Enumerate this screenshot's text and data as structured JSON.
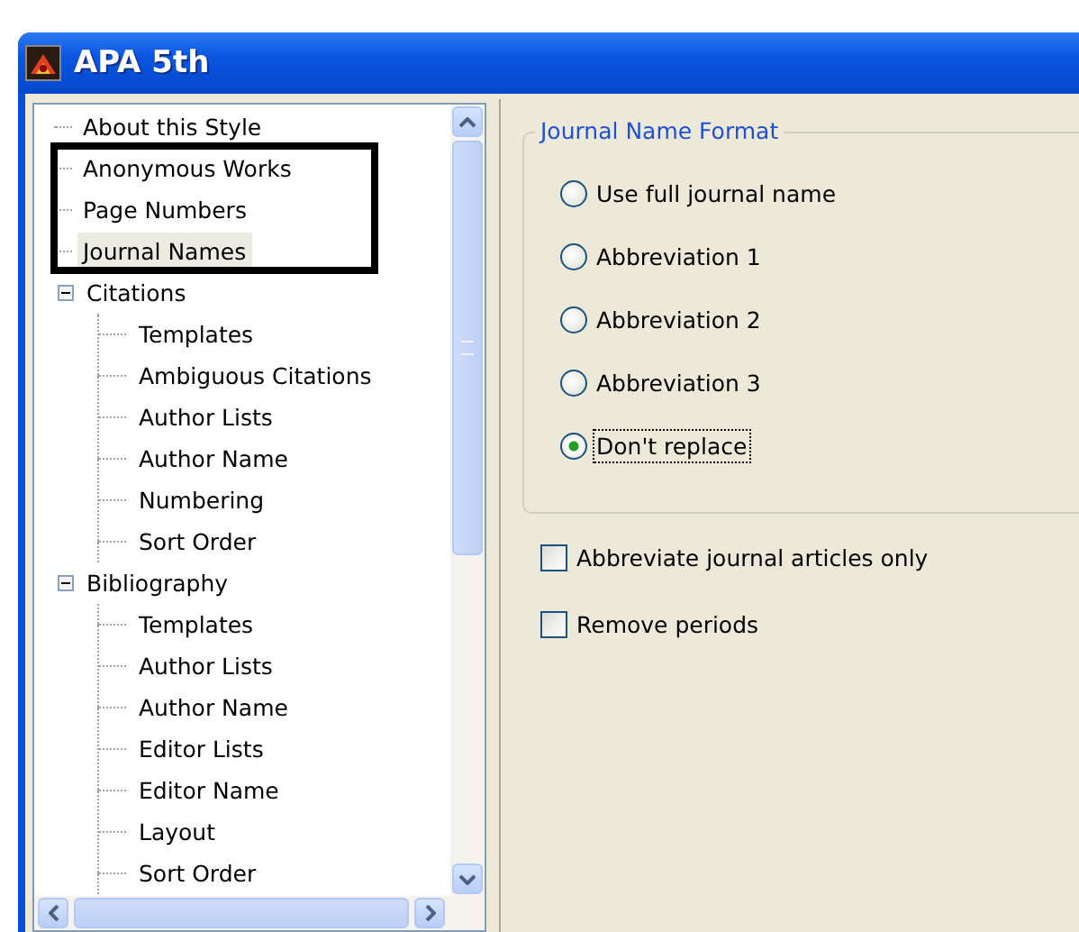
{
  "window": {
    "title": "APA 5th"
  },
  "tree": {
    "items": [
      {
        "label": "About this Style",
        "selected": false
      },
      {
        "label": "Anonymous Works",
        "selected": false
      },
      {
        "label": "Page Numbers",
        "selected": false
      },
      {
        "label": "Journal Names",
        "selected": true
      },
      {
        "label": "Citations",
        "selected": false,
        "expanded": true,
        "children": [
          {
            "label": "Templates",
            "selected": false
          },
          {
            "label": "Ambiguous Citations",
            "selected": false
          },
          {
            "label": "Author Lists",
            "selected": false
          },
          {
            "label": "Author Name",
            "selected": false
          },
          {
            "label": "Numbering",
            "selected": false
          },
          {
            "label": "Sort Order",
            "selected": false
          }
        ]
      },
      {
        "label": "Bibliography",
        "selected": false,
        "expanded": true,
        "children": [
          {
            "label": "Templates",
            "selected": false
          },
          {
            "label": "Author Lists",
            "selected": false
          },
          {
            "label": "Author Name",
            "selected": false
          },
          {
            "label": "Editor Lists",
            "selected": false
          },
          {
            "label": "Editor Name",
            "selected": false
          },
          {
            "label": "Layout",
            "selected": false
          },
          {
            "label": "Sort Order",
            "selected": false
          }
        ]
      }
    ]
  },
  "group": {
    "title": "Journal Name Format",
    "options": [
      {
        "label": "Use full journal name",
        "selected": false
      },
      {
        "label": "Abbreviation 1",
        "selected": false
      },
      {
        "label": "Abbreviation 2",
        "selected": false
      },
      {
        "label": "Abbreviation 3",
        "selected": false
      },
      {
        "label": "Don't replace",
        "selected": true
      }
    ]
  },
  "checkboxes": [
    {
      "label": "Abbreviate journal articles only",
      "checked": false
    },
    {
      "label": "Remove periods",
      "checked": false
    }
  ]
}
